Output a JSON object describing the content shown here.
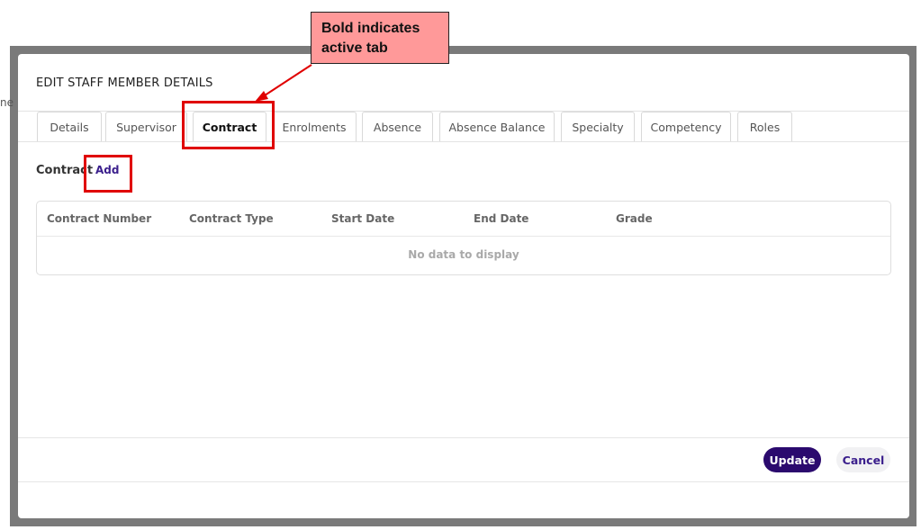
{
  "background": {
    "peek_text": "ne"
  },
  "modal": {
    "title": "EDIT STAFF MEMBER DETAILS",
    "tabs": [
      {
        "label": "Details",
        "active": false
      },
      {
        "label": "Supervisor",
        "active": false
      },
      {
        "label": "Contract",
        "active": true
      },
      {
        "label": "Enrolments",
        "active": false
      },
      {
        "label": "Absence",
        "active": false
      },
      {
        "label": "Absence Balance",
        "active": false
      },
      {
        "label": "Specialty",
        "active": false
      },
      {
        "label": "Competency",
        "active": false
      },
      {
        "label": "Roles",
        "active": false
      }
    ],
    "section_label": "Contract",
    "add_label": "Add",
    "table": {
      "columns": [
        "Contract Number",
        "Contract Type",
        "Start Date",
        "End Date",
        "Grade"
      ],
      "empty_message": "No data to display"
    },
    "footer": {
      "update_label": "Update",
      "cancel_label": "Cancel"
    }
  },
  "annotation": {
    "callout_text": "Bold indicates active tab",
    "color": "#e00000",
    "callout_bg": "#ff9999"
  },
  "colors": {
    "primary": "#2b0a6e",
    "link": "#3a1e8c"
  }
}
